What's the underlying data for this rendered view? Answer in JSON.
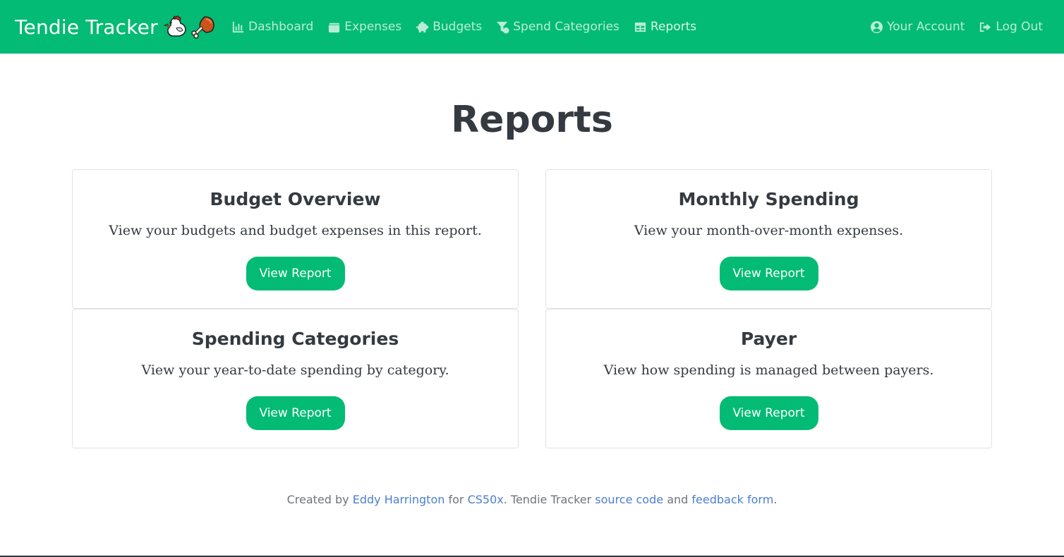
{
  "brand": {
    "title": "Tendie Tracker"
  },
  "nav": {
    "left": [
      {
        "label": "Dashboard",
        "icon": "bar-chart-icon"
      },
      {
        "label": "Expenses",
        "icon": "wallet-icon"
      },
      {
        "label": "Budgets",
        "icon": "piggy-bank-icon"
      },
      {
        "label": "Spend Categories",
        "icon": "filter-dollar-icon"
      },
      {
        "label": "Reports",
        "icon": "table-icon"
      }
    ],
    "right": [
      {
        "label": "Your Account",
        "icon": "user-circle-icon"
      },
      {
        "label": "Log Out",
        "icon": "sign-out-icon"
      }
    ]
  },
  "page": {
    "title": "Reports"
  },
  "cards": [
    {
      "title": "Budget Overview",
      "text": "View your budgets and budget expenses in this report.",
      "button": "View Report"
    },
    {
      "title": "Monthly Spending",
      "text": "View your month-over-month expenses.",
      "button": "View Report"
    },
    {
      "title": "Spending Categories",
      "text": "View your year-to-date spending by category.",
      "button": "View Report"
    },
    {
      "title": "Payer",
      "text": "View how spending is managed between payers.",
      "button": "View Report"
    }
  ],
  "footer": {
    "created_by": "Created by",
    "author": "Eddy Harrington",
    "for": "for",
    "course": "CS50x",
    "mid": ". Tendie Tracker",
    "source": "source code",
    "and": "and",
    "feedback": "feedback form",
    "end": "."
  },
  "colors": {
    "brand_green": "#03bb74",
    "text_dark": "#343a40",
    "link_blue": "#4a7fd0"
  }
}
